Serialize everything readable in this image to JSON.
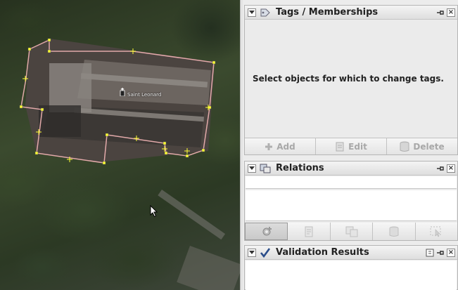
{
  "map": {
    "poi_label": "Saint Leonard"
  },
  "panels": {
    "tags": {
      "title": "Tags / Memberships",
      "empty_message": "Select objects for which to change tags.",
      "buttons": {
        "add": "Add",
        "edit": "Edit",
        "delete": "Delete"
      }
    },
    "relations": {
      "title": "Relations"
    },
    "validation": {
      "title": "Validation Results"
    }
  },
  "colors": {
    "way_outline": "#e2a9a9",
    "node_marker": "#ffff33",
    "panel_bg": "#ececec"
  },
  "icons": {
    "tags": "tag-icon",
    "relations": "relation-icon",
    "validation": "checkmark-icon",
    "add": "plus-icon",
    "edit": "edit-icon",
    "delete": "trash-icon"
  }
}
